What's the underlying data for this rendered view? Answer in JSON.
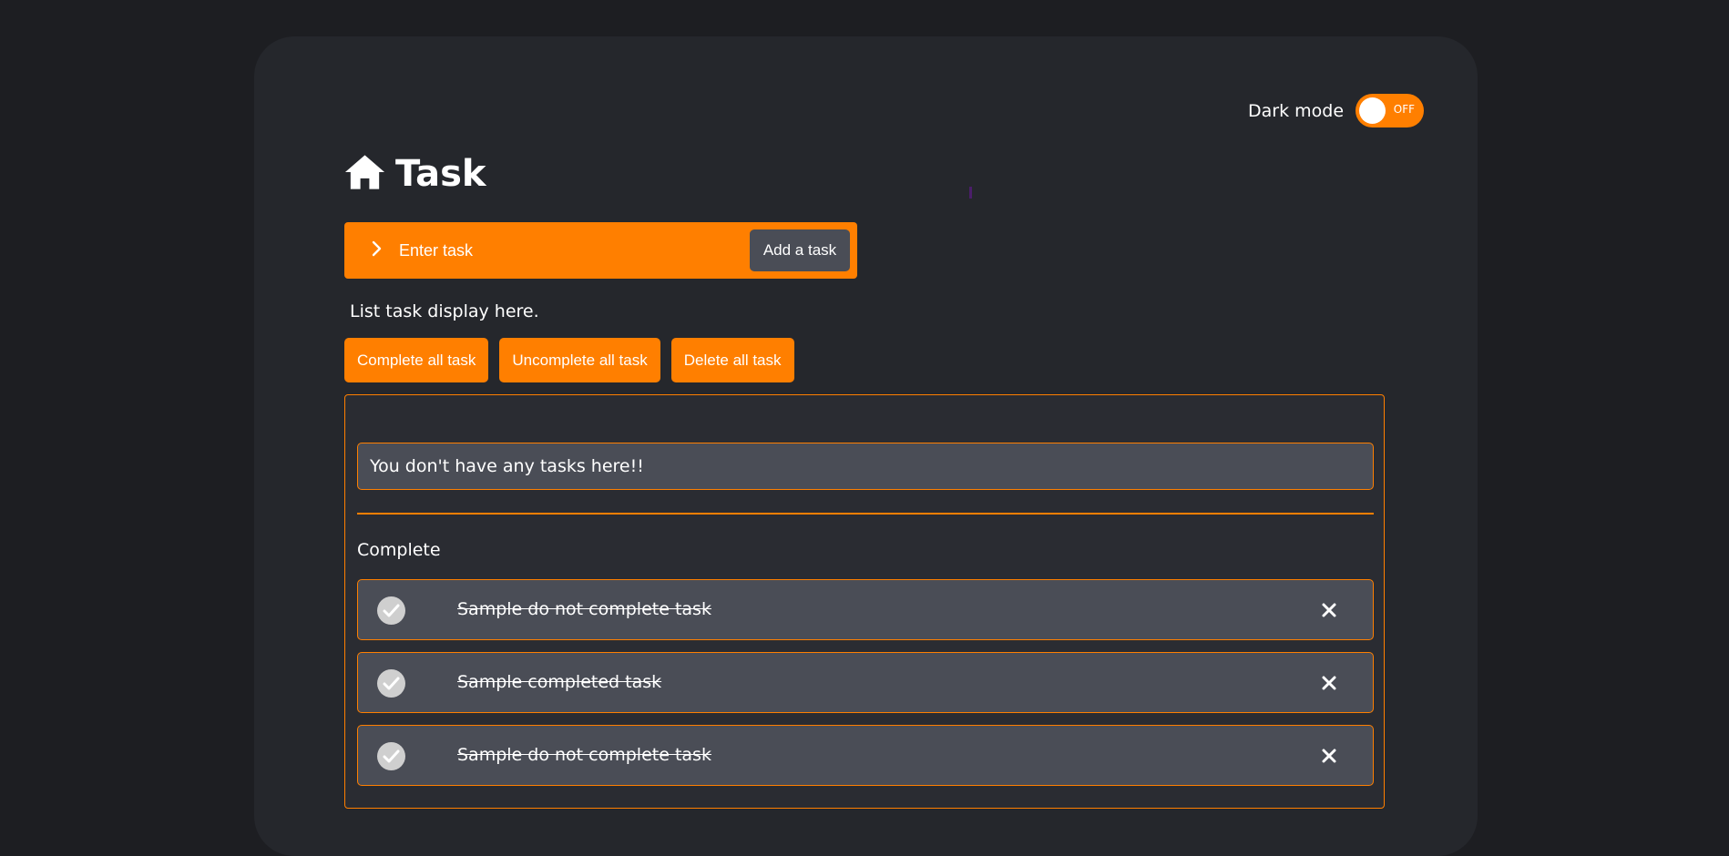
{
  "dark_mode": {
    "label": "Dark mode",
    "state": "OFF"
  },
  "header": {
    "title": "Task",
    "icon": "home-icon"
  },
  "task_form": {
    "icon": "chevron-right-icon",
    "placeholder": "Enter task",
    "value": "",
    "add_label": "Add a task"
  },
  "list": {
    "caption": "List task display here.",
    "actions": {
      "complete_all": "Complete all task",
      "uncomplete_all": "Uncomplete all task",
      "delete_all": "Delete all task"
    },
    "empty_message": "You don't have any tasks here!!",
    "complete_heading": "Complete",
    "completed_tasks": [
      {
        "text": "Sample do not complete task",
        "done": true
      },
      {
        "text": "Sample completed task",
        "done": true
      },
      {
        "text": "Sample do not complete task",
        "done": true
      }
    ]
  },
  "colors": {
    "accent": "#ff7f00",
    "page_background": "#1d1e22",
    "card_background": "#25272c",
    "item_background": "#4a4d56",
    "text": "#ffffff"
  }
}
